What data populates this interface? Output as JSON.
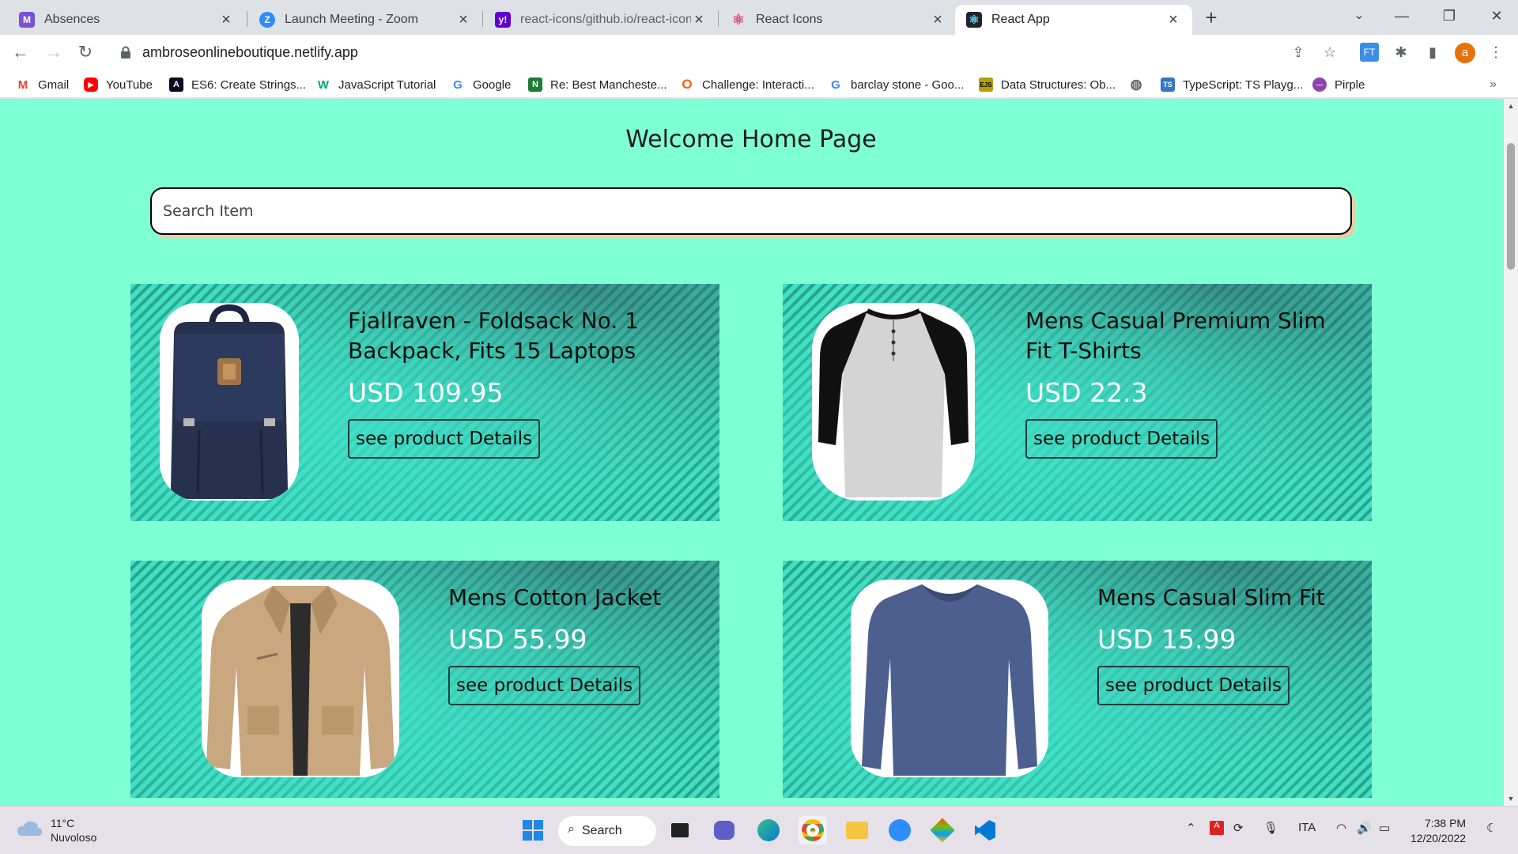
{
  "browser": {
    "tabs": [
      {
        "title": "Absences",
        "icon": "absences-icon",
        "color": "#7b4fd6",
        "glyph": "M"
      },
      {
        "title": "Launch Meeting - Zoom",
        "icon": "zoom-icon",
        "color": "#2d8cff",
        "glyph": "Z"
      },
      {
        "title": "react-icons/github.io/react-icons",
        "icon": "yahoo-icon",
        "color": "#6001d2",
        "glyph": "y!"
      },
      {
        "title": "React Icons",
        "icon": "react-icon",
        "color": "#e0457b",
        "glyph": "⚛"
      },
      {
        "title": "React App",
        "icon": "react-icon",
        "color": "#20232a",
        "glyph": "⚛"
      }
    ],
    "url": "ambroseonlineboutique.netlify.app",
    "bookmarks": [
      {
        "label": "Gmail",
        "icon": "gmail-icon",
        "color": "#ea4335",
        "glyph": "M"
      },
      {
        "label": "YouTube",
        "icon": "youtube-icon",
        "color": "#ff0000",
        "glyph": "▶"
      },
      {
        "label": "ES6: Create Strings...",
        "icon": "freecodecamp-icon",
        "color": "#0a0a23",
        "glyph": "A"
      },
      {
        "label": "JavaScript Tutorial",
        "icon": "w3schools-icon",
        "color": "#04aa6d",
        "glyph": "W"
      },
      {
        "label": "Google",
        "icon": "google-icon",
        "color": "#4285f4",
        "glyph": "G"
      },
      {
        "label": "Re: Best Mancheste...",
        "icon": "forum-icon",
        "color": "#1e7b34",
        "glyph": "N"
      },
      {
        "label": "Challenge: Interacti...",
        "icon": "khan-icon",
        "color": "#ff5a1f",
        "glyph": "O"
      },
      {
        "label": "barclay stone - Goo...",
        "icon": "google-icon",
        "color": "#4285f4",
        "glyph": "G"
      },
      {
        "label": "Data Structures: Ob...",
        "icon": "ejs-icon",
        "color": "#b4a00a",
        "glyph": "EJS"
      },
      {
        "label": "",
        "icon": "globe-icon",
        "color": "#5f6368",
        "glyph": "◍"
      },
      {
        "label": "TypeScript: TS Playg...",
        "icon": "typescript-icon",
        "color": "#3178c6",
        "glyph": "TS"
      },
      {
        "label": "Pirple",
        "icon": "pirple-icon",
        "color": "#8e44ad",
        "glyph": "●"
      }
    ]
  },
  "page": {
    "title": "Welcome Home Page",
    "search_placeholder": "Search Item",
    "products": [
      {
        "name": "Fjallraven - Foldsack No. 1 Backpack, Fits 15 Laptops",
        "price": "USD 109.95",
        "button": "see product Details",
        "image": "backpack-image"
      },
      {
        "name": "Mens Casual Premium Slim Fit T-Shirts",
        "price": "USD 22.3",
        "button": "see product Details",
        "image": "tshirt-image"
      },
      {
        "name": "Mens Cotton Jacket",
        "price": "USD 55.99",
        "button": "see product Details",
        "image": "jacket-image"
      },
      {
        "name": "Mens Casual Slim Fit",
        "price": "USD 15.99",
        "button": "see product Details",
        "image": "longsleeve-image"
      }
    ]
  },
  "taskbar": {
    "weather_temp": "11°C",
    "weather_desc": "Nuvoloso",
    "search_label": "Search",
    "language": "ITA",
    "time": "7:38 PM",
    "date": "12/20/2022"
  },
  "colors": {
    "page_background": "#7fffd4",
    "card_teal": "#40e0c0",
    "profile_orange": "#e8710a"
  }
}
